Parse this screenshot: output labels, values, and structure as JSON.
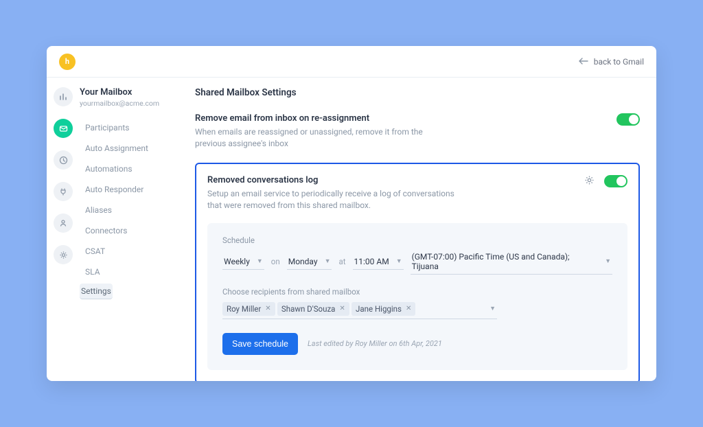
{
  "header": {
    "logo_glyph": "h",
    "back_label": "back to Gmail"
  },
  "sidebar": {
    "title": "Your Mailbox",
    "email": "yourmailbox@acme.com",
    "items": [
      {
        "label": "Participants"
      },
      {
        "label": "Auto Assignment"
      },
      {
        "label": "Automations"
      },
      {
        "label": "Auto Responder"
      },
      {
        "label": "Aliases"
      },
      {
        "label": "Connectors"
      },
      {
        "label": "CSAT"
      },
      {
        "label": "SLA"
      },
      {
        "label": "Settings"
      }
    ],
    "selected_index": 8
  },
  "page": {
    "title": "Shared Mailbox Settings"
  },
  "section_remove": {
    "title": "Remove email from inbox on re-assignment",
    "desc": "When emails are reassigned or unassigned, remove it from the previous assignee's inbox",
    "toggle_on": true
  },
  "section_log": {
    "title": "Removed conversations log",
    "desc": "Setup an email service to periodically receive a log of conversations that were removed from this shared mailbox.",
    "toggle_on": true
  },
  "schedule": {
    "label": "Schedule",
    "frequency": "Weekly",
    "on_label": "on",
    "day": "Monday",
    "at_label": "at",
    "time": "11:00 AM",
    "timezone": "(GMT-07:00) Pacific Time (US and Canada); Tijuana"
  },
  "recipients": {
    "label": "Choose recipients from shared mailbox",
    "chips": [
      "Roy Miller",
      "Shawn D'Souza",
      "Jane Higgins"
    ]
  },
  "actions": {
    "save_label": "Save schedule",
    "last_edited": "Last edited by Roy Miller on 6th Apr, 2021"
  }
}
